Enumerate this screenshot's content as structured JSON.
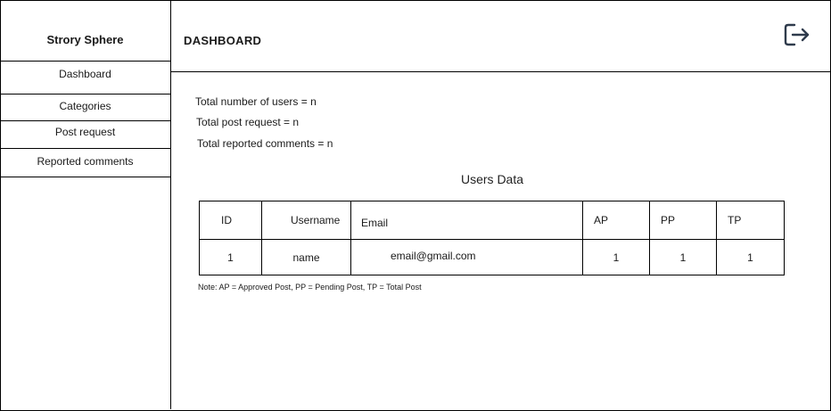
{
  "sidebar": {
    "brand": "Strory Sphere",
    "items": [
      {
        "label": "Dashboard"
      },
      {
        "label": "Categories"
      },
      {
        "label": "Post request"
      },
      {
        "label": "Reported comments"
      }
    ]
  },
  "header": {
    "title": "DASHBOARD",
    "logout_icon": "logout-icon"
  },
  "stats": {
    "total_users": "Total number of users = n",
    "total_post_requests": "Total post request = n",
    "total_reported_comments": "Total reported comments = n"
  },
  "users_table": {
    "title": "Users Data",
    "columns": [
      "ID",
      "Username",
      "Email",
      "AP",
      "PP",
      "TP"
    ],
    "rows": [
      [
        "1",
        "name",
        "email@gmail.com",
        "1",
        "1",
        "1"
      ]
    ]
  },
  "note": "Note: AP = Approved Post, PP = Pending Post, TP = Total Post",
  "colors": {
    "border": "#000000",
    "icon": "#2f3b4c",
    "background": "#ffffff"
  }
}
